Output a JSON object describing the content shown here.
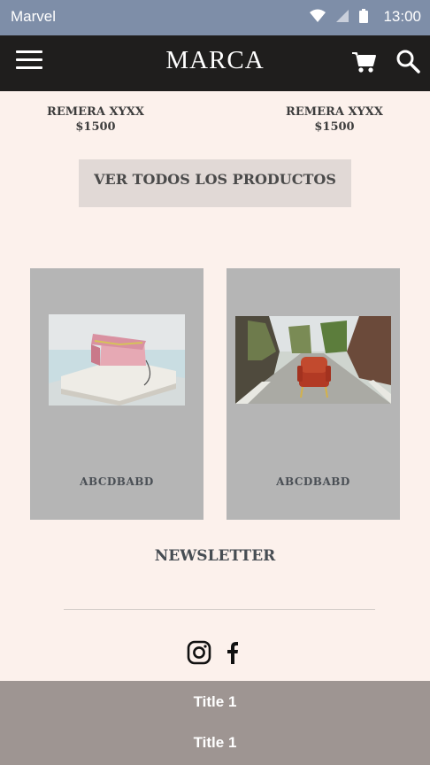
{
  "status_bar": {
    "carrier": "Marvel",
    "time": "13:00"
  },
  "header": {
    "brand": "MARCA"
  },
  "products": [
    {
      "name": "REMERA XYXX",
      "price": "$1500"
    },
    {
      "name": "REMERA XYXX",
      "price": "$1500"
    }
  ],
  "view_all_label": "VER TODOS LOS PRODUCTOS",
  "cards": [
    {
      "label": "ABCDBABD"
    },
    {
      "label": "ABCDBABD"
    }
  ],
  "newsletter_label": "NEWSLETTER",
  "footer": {
    "items": [
      "Title 1",
      "Title 1"
    ]
  },
  "colors": {
    "statusbar": "#7e8ea8",
    "topbar": "#1f1e1d",
    "background": "#fcf1ec",
    "button": "#e1d9d6",
    "card": "#b5b5b5",
    "footer": "#9e9592"
  }
}
